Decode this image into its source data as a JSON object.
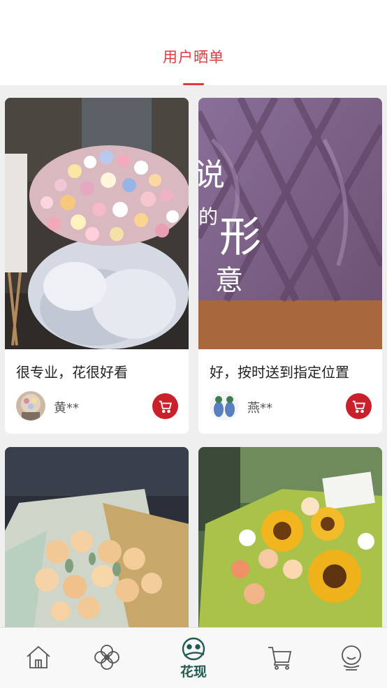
{
  "header": {
    "title": "用户晒单"
  },
  "reviews": [
    {
      "text": "很专业，花很好看",
      "user": "黄**"
    },
    {
      "text": "好，按时送到指定位置",
      "user": "燕**"
    },
    {
      "text": "",
      "user": ""
    },
    {
      "text": "",
      "user": ""
    }
  ],
  "photo_overlay": {
    "big1": "说",
    "small1": "的",
    "big2": "形",
    "big3": "意"
  },
  "tabbar": {
    "items": [
      {
        "label": "",
        "icon": "home-icon"
      },
      {
        "label": "",
        "icon": "flower-icon"
      },
      {
        "label": "花现",
        "icon": "discover-icon"
      },
      {
        "label": "",
        "icon": "cart-icon"
      },
      {
        "label": "",
        "icon": "profile-icon"
      }
    ],
    "active_index": 2
  },
  "colors": {
    "accent": "#e0393e",
    "cart_button": "#c9202a",
    "tab_active": "#1f5b4f"
  }
}
